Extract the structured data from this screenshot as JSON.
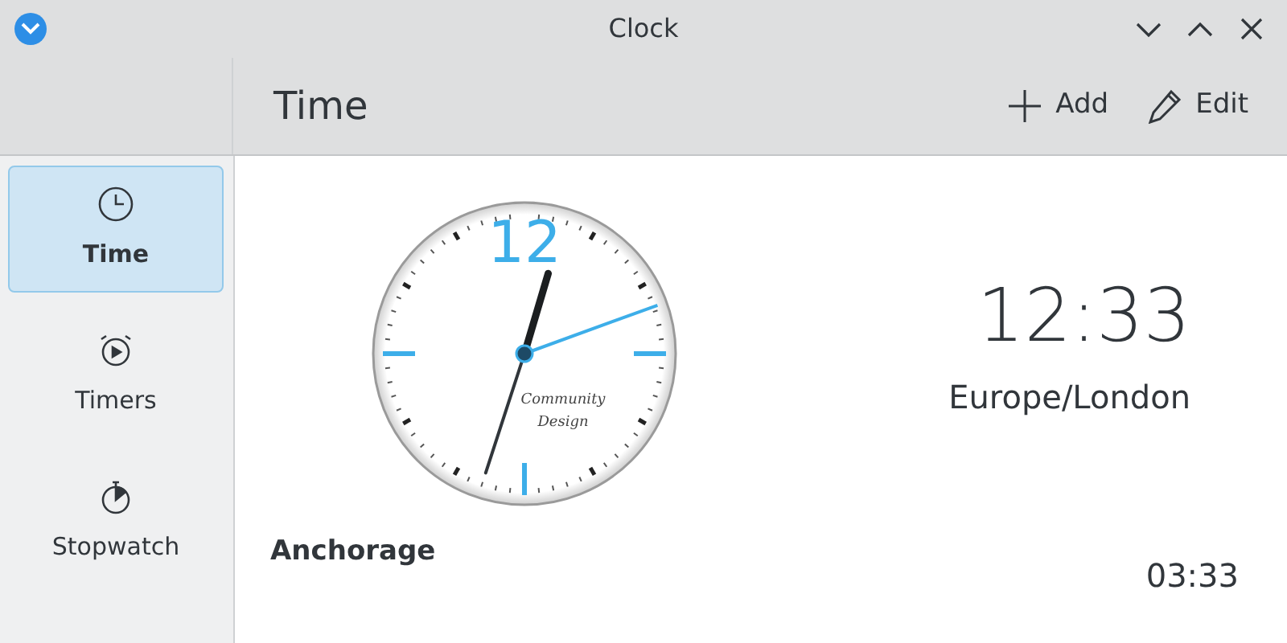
{
  "window": {
    "title": "Clock"
  },
  "toolbar": {
    "title": "Time",
    "actions": [
      {
        "kind": "add",
        "label": "Add"
      },
      {
        "kind": "edit",
        "label": "Edit"
      }
    ]
  },
  "sidebar": {
    "items": [
      {
        "kind": "time",
        "label": "Time",
        "selected": true
      },
      {
        "kind": "timers",
        "label": "Timers",
        "selected": false
      },
      {
        "kind": "stopwatch",
        "label": "Stopwatch",
        "selected": false
      }
    ]
  },
  "main_clock": {
    "dial_number": "12",
    "dial_caption": [
      "Community",
      "Design"
    ],
    "time": "12:33",
    "timezone": "Europe/London"
  },
  "cities": [
    {
      "name": "Anchorage",
      "time": "03:33"
    }
  ]
}
